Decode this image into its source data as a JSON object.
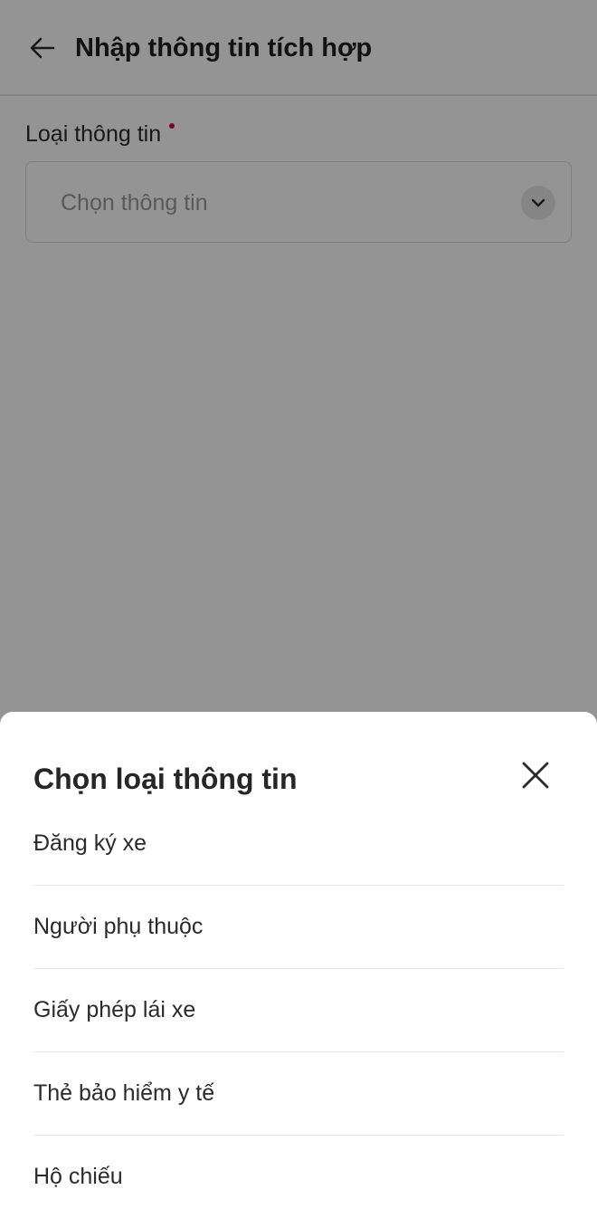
{
  "header": {
    "back_icon": "arrow-left-icon",
    "title": "Nhập thông tin tích hợp"
  },
  "form": {
    "label": "Loại thông tin",
    "required_color": "#c8102e",
    "select": {
      "placeholder": "Chọn thông tin",
      "chevron_icon": "chevron-down-icon"
    }
  },
  "sheet": {
    "title": "Chọn loại thông tin",
    "close_icon": "close-icon",
    "options": [
      {
        "label": "Đăng ký xe"
      },
      {
        "label": "Người phụ thuộc"
      },
      {
        "label": "Giấy phép lái xe"
      },
      {
        "label": "Thẻ bảo hiểm y tế"
      },
      {
        "label": "Hộ chiếu"
      }
    ]
  }
}
